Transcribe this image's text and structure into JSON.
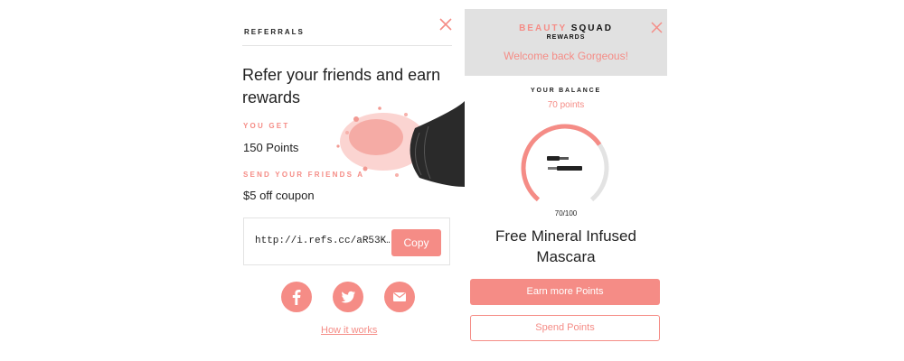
{
  "referrals": {
    "title": "REFERRALS",
    "headline": "Refer your friends and earn rewards",
    "you_get_label": "YOU GET",
    "you_get_value": "150 Points",
    "send_label": "SEND YOUR FRIENDS A",
    "send_value": "$5 off coupon",
    "referral_link": "http://i.refs.cc/aR53K…",
    "copy_label": "Copy",
    "how_it_works": "How it works",
    "social_icons": [
      "facebook-icon",
      "twitter-icon",
      "mail-icon"
    ]
  },
  "rewards": {
    "brand_part1": "BEAUTY",
    "brand_part2": "SQUAD",
    "brand_sub": "REWARDS",
    "welcome": "Welcome back Gorgeous!",
    "balance_label": "YOUR BALANCE",
    "balance_value": "70 points",
    "progress_text": "70/100",
    "progress_fraction": 0.7,
    "reward_name": "Free Mineral Infused Mascara",
    "earn_label": "Earn more Points",
    "spend_label": "Spend Points"
  },
  "colors": {
    "accent": "#f58c86",
    "banner_bg": "#e1e1e1",
    "track": "#e3e3e3"
  }
}
